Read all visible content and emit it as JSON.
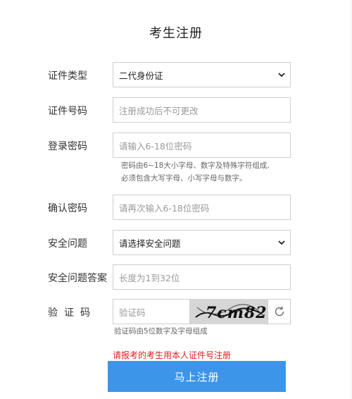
{
  "title": "考生注册",
  "form": {
    "id_type": {
      "label": "证件类型",
      "value": "二代身份证"
    },
    "id_number": {
      "label": "证件号码",
      "placeholder": "注册成功后不可更改"
    },
    "password": {
      "label": "登录密码",
      "placeholder": "请输入6-18位密码",
      "hint_line1": "密码由6~18大小字母、数字及特殊字符组成,",
      "hint_line2": "必须包含大写字母、小写字母与数字。"
    },
    "confirm_password": {
      "label": "确认密码",
      "placeholder": "请再次输入6-18位密码"
    },
    "security_question": {
      "label": "安全问题",
      "value": "请选择安全问题"
    },
    "security_answer": {
      "label": "安全问题答案",
      "placeholder": "长度为1到32位"
    },
    "captcha": {
      "label": "验证码",
      "placeholder": "验证码",
      "image_text": "7cm82",
      "hint": "验证码由5位数字及字母组成"
    }
  },
  "warning": "请报考的考生用本人证件号注册",
  "submit_label": "马上注册",
  "colors": {
    "primary": "#3d95ea",
    "warning": "#e02020"
  }
}
